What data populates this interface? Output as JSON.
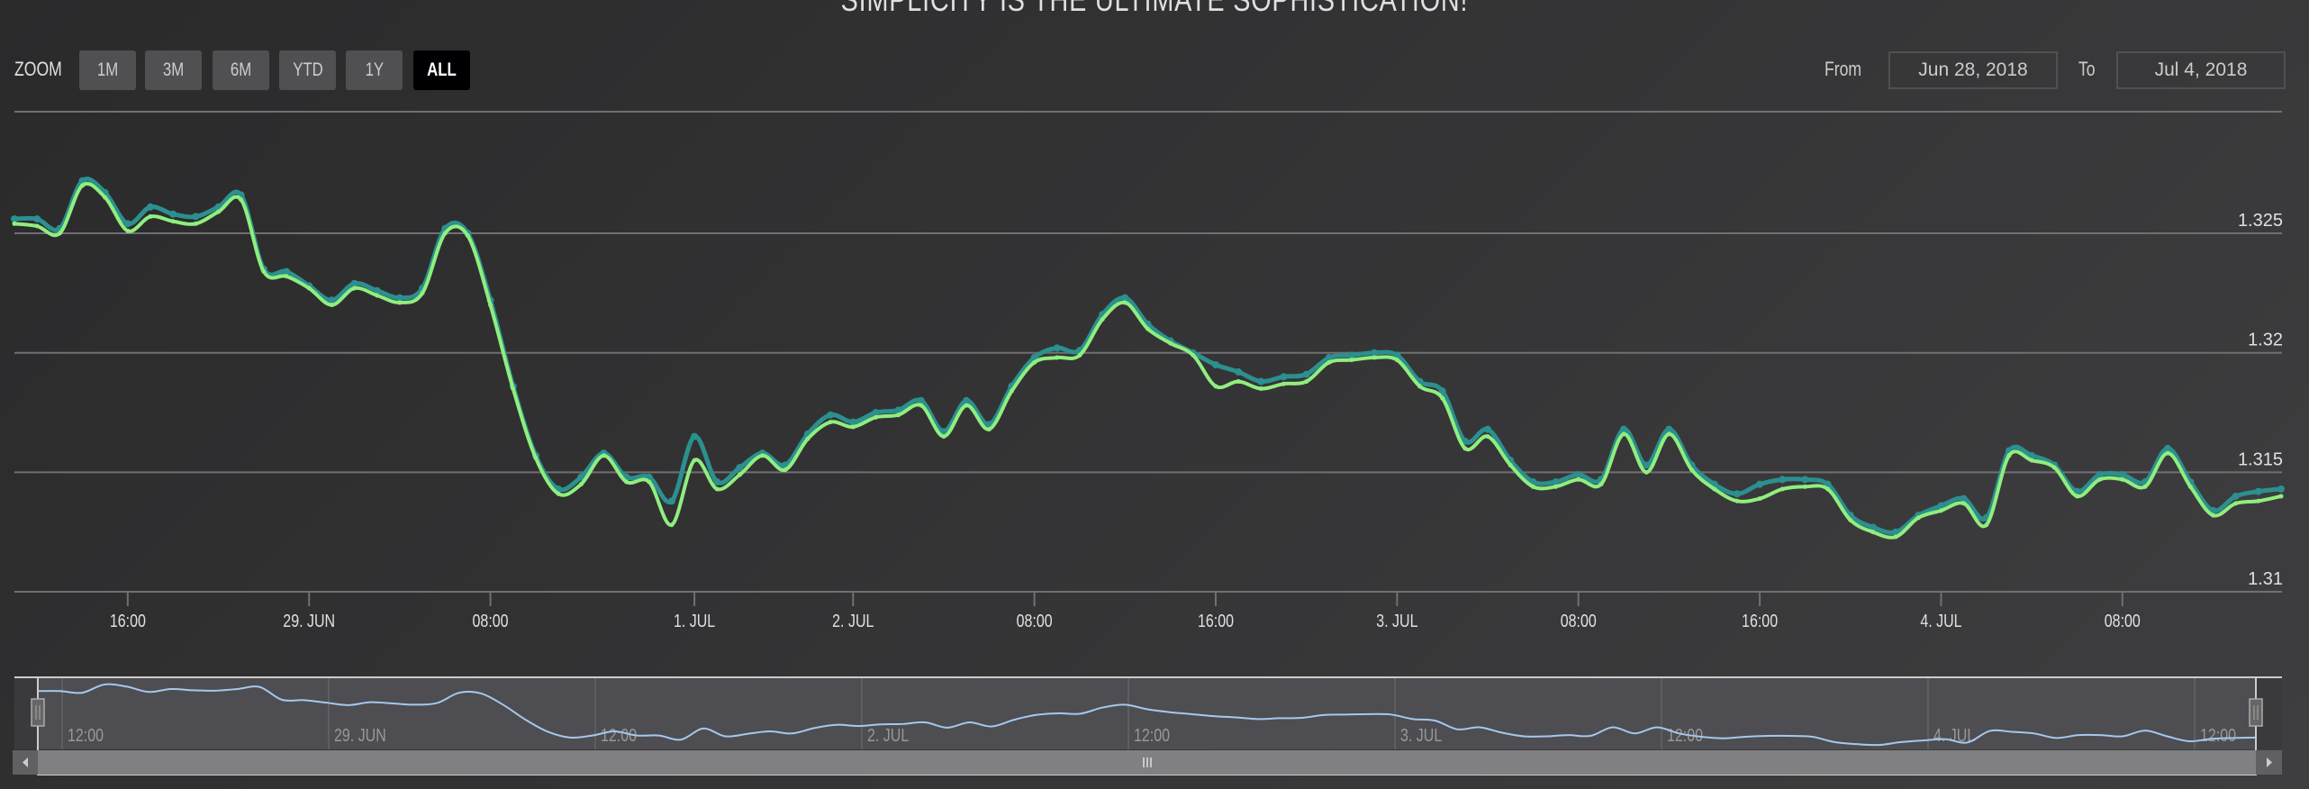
{
  "title": "SIMPLICITY IS THE ULTIMATE SOPHISTICATION!",
  "range_selector": {
    "zoom_label": "Zoom",
    "buttons": [
      {
        "label": "1m",
        "active": false
      },
      {
        "label": "3m",
        "active": false
      },
      {
        "label": "6m",
        "active": false
      },
      {
        "label": "YTD",
        "active": false
      },
      {
        "label": "1y",
        "active": false
      },
      {
        "label": "All",
        "active": true
      }
    ],
    "from_label": "From",
    "from_value": "Jun 28, 2018",
    "to_label": "To",
    "to_value": "Jul 4, 2018"
  },
  "colors": {
    "series_1": "#2b908f",
    "series_2": "#90ee7e",
    "navigator_series": "#a6c7ed",
    "gridline": "#707073",
    "background": "#2e2e30"
  },
  "chart_data": {
    "type": "line",
    "x_axis_type": "ordinal datetime (hourly points)",
    "ylim": [
      1.31,
      1.33
    ],
    "grid": true,
    "y_ticks": [
      {
        "value": 1.31,
        "label": "1.31"
      },
      {
        "value": 1.315,
        "label": "1.315"
      },
      {
        "value": 1.32,
        "label": "1.32"
      },
      {
        "value": 1.325,
        "label": "1.325"
      }
    ],
    "x_ticks": [
      {
        "label": "16:00",
        "point_index": 5
      },
      {
        "label": "29. Jun",
        "point_index": 13
      },
      {
        "label": "08:00",
        "point_index": 21
      },
      {
        "label": "1. Jul",
        "point_index": 30
      },
      {
        "label": "2. Jul",
        "point_index": 37
      },
      {
        "label": "08:00",
        "point_index": 45
      },
      {
        "label": "16:00",
        "point_index": 53
      },
      {
        "label": "3. Jul",
        "point_index": 61
      },
      {
        "label": "08:00",
        "point_index": 69
      },
      {
        "label": "16:00",
        "point_index": 77
      },
      {
        "label": "4. Jul",
        "point_index": 85
      },
      {
        "label": "08:00",
        "point_index": 93
      }
    ],
    "series": [
      {
        "color": "#2b908f",
        "values": [
          1.3256,
          1.3256,
          1.3252,
          1.3272,
          1.3267,
          1.3254,
          1.3261,
          1.3258,
          1.3257,
          1.3261,
          1.3266,
          1.3235,
          1.3234,
          1.3228,
          1.3222,
          1.3229,
          1.3226,
          1.3223,
          1.3227,
          1.3252,
          1.325,
          1.3222,
          1.3186,
          1.3157,
          1.3143,
          1.3148,
          1.3158,
          1.3148,
          1.3148,
          1.3138,
          1.3165,
          1.3146,
          1.3152,
          1.3158,
          1.3153,
          1.3166,
          1.3174,
          1.3171,
          1.3175,
          1.3176,
          1.318,
          1.3167,
          1.318,
          1.317,
          1.3186,
          1.3198,
          1.3202,
          1.3201,
          1.3216,
          1.3223,
          1.3212,
          1.3205,
          1.32,
          1.3195,
          1.3192,
          1.3188,
          1.319,
          1.3191,
          1.3198,
          1.3199,
          1.32,
          1.3199,
          1.3188,
          1.3184,
          1.3163,
          1.3168,
          1.3155,
          1.3146,
          1.3146,
          1.3149,
          1.3147,
          1.3168,
          1.3153,
          1.3168,
          1.3153,
          1.3145,
          1.3141,
          1.3145,
          1.3147,
          1.3147,
          1.3145,
          1.3132,
          1.3127,
          1.3125,
          1.3132,
          1.3136,
          1.3139,
          1.3131,
          1.3159,
          1.3157,
          1.3153,
          1.3142,
          1.3149,
          1.3149,
          1.3146,
          1.316,
          1.3146,
          1.3134,
          1.314,
          1.3142,
          1.3143
        ]
      },
      {
        "color": "#90ee7e",
        "values": [
          1.3254,
          1.3253,
          1.325,
          1.327,
          1.3265,
          1.3251,
          1.3257,
          1.3255,
          1.3254,
          1.3259,
          1.3264,
          1.3234,
          1.3232,
          1.3227,
          1.322,
          1.3227,
          1.3224,
          1.3221,
          1.3225,
          1.325,
          1.3249,
          1.322,
          1.3185,
          1.3156,
          1.3141,
          1.3145,
          1.3157,
          1.3146,
          1.3146,
          1.3128,
          1.3155,
          1.3143,
          1.3149,
          1.3157,
          1.3151,
          1.3164,
          1.3171,
          1.3169,
          1.3173,
          1.3174,
          1.3178,
          1.3165,
          1.3178,
          1.3168,
          1.3184,
          1.3196,
          1.3198,
          1.3199,
          1.3214,
          1.3221,
          1.321,
          1.3204,
          1.3199,
          1.3186,
          1.3188,
          1.3185,
          1.3187,
          1.3188,
          1.3196,
          1.3197,
          1.3198,
          1.3197,
          1.3186,
          1.3181,
          1.316,
          1.3165,
          1.3153,
          1.3144,
          1.3144,
          1.3147,
          1.3145,
          1.3166,
          1.315,
          1.3166,
          1.3151,
          1.3143,
          1.3138,
          1.3139,
          1.3143,
          1.3144,
          1.3143,
          1.313,
          1.3125,
          1.3123,
          1.3131,
          1.3134,
          1.3137,
          1.3128,
          1.3157,
          1.3155,
          1.3152,
          1.314,
          1.3147,
          1.3147,
          1.3144,
          1.3158,
          1.3144,
          1.3132,
          1.3137,
          1.3138,
          1.314
        ]
      }
    ]
  },
  "navigator": {
    "labels": [
      "12:00",
      "29. Jun",
      "12:00",
      "2. Jul",
      "12:00",
      "3. Jul",
      "12:00",
      "4. Jul",
      "12:00"
    ],
    "selected_range_percent": [
      0,
      100
    ]
  }
}
